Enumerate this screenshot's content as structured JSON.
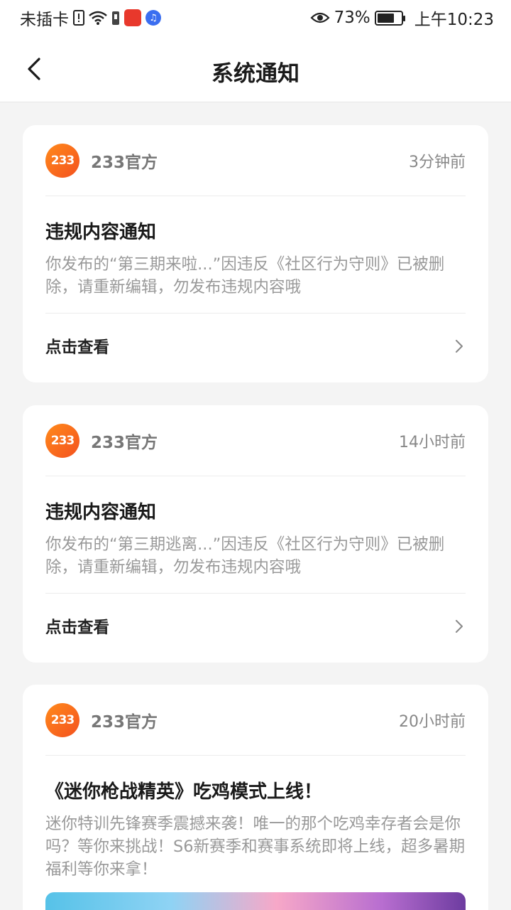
{
  "status_bar": {
    "carrier": "未插卡",
    "battery_percent": "73%",
    "battery_level": 0.73,
    "time": "上午10:23",
    "icons": [
      "sim-alert-icon",
      "wifi-icon",
      "sim-icon",
      "app-red-icon",
      "music-icon",
      "eye-icon",
      "battery-icon"
    ]
  },
  "nav": {
    "title": "系统通知",
    "back_icon": "chevron-left-icon"
  },
  "notifications": [
    {
      "sender": "233官方",
      "logo_text": "233",
      "time": "3分钟前",
      "title": "违规内容通知",
      "body": "你发布的“第三期来啦...”因违反《社区行为守则》已被删除，请重新编辑，勿发布违规内容哦",
      "action": "点击查看"
    },
    {
      "sender": "233官方",
      "logo_text": "233",
      "time": "14小时前",
      "title": "违规内容通知",
      "body": "你发布的“第三期逃离...”因违反《社区行为守则》已被删除，请重新编辑，勿发布违规内容哦",
      "action": "点击查看"
    },
    {
      "sender": "233官方",
      "logo_text": "233",
      "time": "20小时前",
      "title": "《迷你枪战精英》吃鸡模式上线！",
      "body": "迷你特训先锋赛季震撼来袭！唯一的那个吃鸡幸存者会是你吗？等你来挑战！S6新赛季和赛事系统即将上线，超多暑期福利等你来拿！"
    }
  ]
}
